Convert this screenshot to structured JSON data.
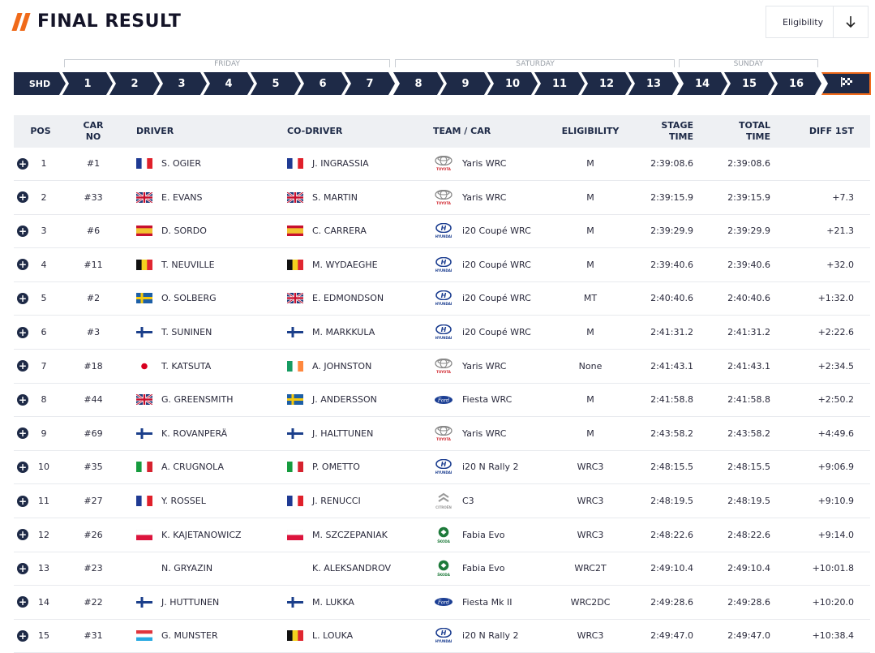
{
  "header": {
    "title": "FINAL RESULT"
  },
  "eligibility_filter": {
    "label": "Eligibility",
    "icon": "arrow-down-icon"
  },
  "days": [
    {
      "label": "FRIDAY"
    },
    {
      "label": "SATURDAY"
    },
    {
      "label": "SUNDAY"
    }
  ],
  "stages": [
    "SHD",
    "1",
    "2",
    "3",
    "4",
    "5",
    "6",
    "7",
    "8",
    "9",
    "10",
    "11",
    "12",
    "13",
    "14",
    "15",
    "16"
  ],
  "finish_icon": "checkered-flag-icon",
  "colors": {
    "accent": "#f06a1a",
    "navy": "#1e2a47",
    "header_bg": "#eef0f3"
  },
  "columns": {
    "pos": "POS",
    "car_no_1": "CAR",
    "car_no_2": "NO",
    "driver": "DRIVER",
    "co_driver": "CO-DRIVER",
    "team_car": "TEAM / CAR",
    "eligibility": "ELIGIBILITY",
    "stage_time_1": "STAGE",
    "stage_time_2": "TIME",
    "total_time_1": "TOTAL",
    "total_time_2": "TIME",
    "diff": "DIFF 1ST"
  },
  "rows": [
    {
      "pos": "1",
      "car": "#1",
      "driver_flag": "france",
      "driver": "S. OGIER",
      "codriver_flag": "france",
      "codriver": "J. INGRASSIA",
      "brand": "toyota",
      "brand_text": "TOYOTA",
      "car_name": "Yaris WRC",
      "elig": "M",
      "stage": "2:39:08.6",
      "total": "2:39:08.6",
      "diff": ""
    },
    {
      "pos": "2",
      "car": "#33",
      "driver_flag": "uk",
      "driver": "E. EVANS",
      "codriver_flag": "uk",
      "codriver": "S. MARTIN",
      "brand": "toyota",
      "brand_text": "TOYOTA",
      "car_name": "Yaris WRC",
      "elig": "M",
      "stage": "2:39:15.9",
      "total": "2:39:15.9",
      "diff": "+7.3"
    },
    {
      "pos": "3",
      "car": "#6",
      "driver_flag": "spain",
      "driver": "D. SORDO",
      "codriver_flag": "spain",
      "codriver": "C. CARRERA",
      "brand": "hyundai",
      "brand_text": "HYUNDAI",
      "car_name": "i20 Coupé WRC",
      "elig": "M",
      "stage": "2:39:29.9",
      "total": "2:39:29.9",
      "diff": "+21.3"
    },
    {
      "pos": "4",
      "car": "#11",
      "driver_flag": "belgium",
      "driver": "T. NEUVILLE",
      "codriver_flag": "belgium",
      "codriver": "M. WYDAEGHE",
      "brand": "hyundai",
      "brand_text": "HYUNDAI",
      "car_name": "i20 Coupé WRC",
      "elig": "M",
      "stage": "2:39:40.6",
      "total": "2:39:40.6",
      "diff": "+32.0"
    },
    {
      "pos": "5",
      "car": "#2",
      "driver_flag": "sweden",
      "driver": "O. SOLBERG",
      "codriver_flag": "uk",
      "codriver": "E. EDMONDSON",
      "brand": "hyundai",
      "brand_text": "HYUNDAI",
      "car_name": "i20 Coupé WRC",
      "elig": "MT",
      "stage": "2:40:40.6",
      "total": "2:40:40.6",
      "diff": "+1:32.0"
    },
    {
      "pos": "6",
      "car": "#3",
      "driver_flag": "finland",
      "driver": "T. SUNINEN",
      "codriver_flag": "finland",
      "codriver": "M. MARKKULA",
      "brand": "hyundai",
      "brand_text": "HYUNDAI",
      "car_name": "i20 Coupé WRC",
      "elig": "M",
      "stage": "2:41:31.2",
      "total": "2:41:31.2",
      "diff": "+2:22.6"
    },
    {
      "pos": "7",
      "car": "#18",
      "driver_flag": "japan",
      "driver": "T. KATSUTA",
      "codriver_flag": "ireland",
      "codriver": "A. JOHNSTON",
      "brand": "toyota",
      "brand_text": "TOYOTA",
      "car_name": "Yaris WRC",
      "elig": "None",
      "stage": "2:41:43.1",
      "total": "2:41:43.1",
      "diff": "+2:34.5"
    },
    {
      "pos": "8",
      "car": "#44",
      "driver_flag": "uk",
      "driver": "G. GREENSMITH",
      "codriver_flag": "sweden",
      "codriver": "J. ANDERSSON",
      "brand": "ford",
      "brand_text": "Ford",
      "car_name": "Fiesta WRC",
      "elig": "M",
      "stage": "2:41:58.8",
      "total": "2:41:58.8",
      "diff": "+2:50.2"
    },
    {
      "pos": "9",
      "car": "#69",
      "driver_flag": "finland",
      "driver": "K. ROVANPERÄ",
      "codriver_flag": "finland",
      "codriver": "J. HALTTUNEN",
      "brand": "toyota",
      "brand_text": "TOYOTA",
      "car_name": "Yaris WRC",
      "elig": "M",
      "stage": "2:43:58.2",
      "total": "2:43:58.2",
      "diff": "+4:49.6"
    },
    {
      "pos": "10",
      "car": "#35",
      "driver_flag": "italy",
      "driver": "A. CRUGNOLA",
      "codriver_flag": "italy",
      "codriver": "P. OMETTO",
      "brand": "hyundai",
      "brand_text": "HYUNDAI",
      "car_name": "i20 N Rally 2",
      "elig": "WRC3",
      "stage": "2:48:15.5",
      "total": "2:48:15.5",
      "diff": "+9:06.9"
    },
    {
      "pos": "11",
      "car": "#27",
      "driver_flag": "france",
      "driver": "Y. ROSSEL",
      "codriver_flag": "france",
      "codriver": "J. RENUCCI",
      "brand": "citroen",
      "brand_text": "CITROËN",
      "car_name": "C3",
      "elig": "WRC3",
      "stage": "2:48:19.5",
      "total": "2:48:19.5",
      "diff": "+9:10.9"
    },
    {
      "pos": "12",
      "car": "#26",
      "driver_flag": "poland",
      "driver": "K. KAJETANOWICZ",
      "codriver_flag": "poland",
      "codriver": "M. SZCZEPANIAK",
      "brand": "skoda",
      "brand_text": "ŠKODA",
      "car_name": "Fabia Evo",
      "elig": "WRC3",
      "stage": "2:48:22.6",
      "total": "2:48:22.6",
      "diff": "+9:14.0"
    },
    {
      "pos": "13",
      "car": "#23",
      "driver_flag": "none",
      "driver": "N. GRYAZIN",
      "codriver_flag": "none",
      "codriver": "K. ALEKSANDROV",
      "brand": "skoda",
      "brand_text": "ŠKODA",
      "car_name": "Fabia Evo",
      "elig": "WRC2T",
      "stage": "2:49:10.4",
      "total": "2:49:10.4",
      "diff": "+10:01.8"
    },
    {
      "pos": "14",
      "car": "#22",
      "driver_flag": "finland",
      "driver": "J. HUTTUNEN",
      "codriver_flag": "finland",
      "codriver": "M. LUKKA",
      "brand": "ford",
      "brand_text": "Ford",
      "car_name": "Fiesta Mk II",
      "elig": "WRC2DC",
      "stage": "2:49:28.6",
      "total": "2:49:28.6",
      "diff": "+10:20.0"
    },
    {
      "pos": "15",
      "car": "#31",
      "driver_flag": "luxembourg",
      "driver": "G. MUNSTER",
      "codriver_flag": "belgium",
      "codriver": "L. LOUKA",
      "brand": "hyundai",
      "brand_text": "HYUNDAI",
      "car_name": "i20 N Rally 2",
      "elig": "WRC3",
      "stage": "2:49:47.0",
      "total": "2:49:47.0",
      "diff": "+10:38.4"
    }
  ]
}
